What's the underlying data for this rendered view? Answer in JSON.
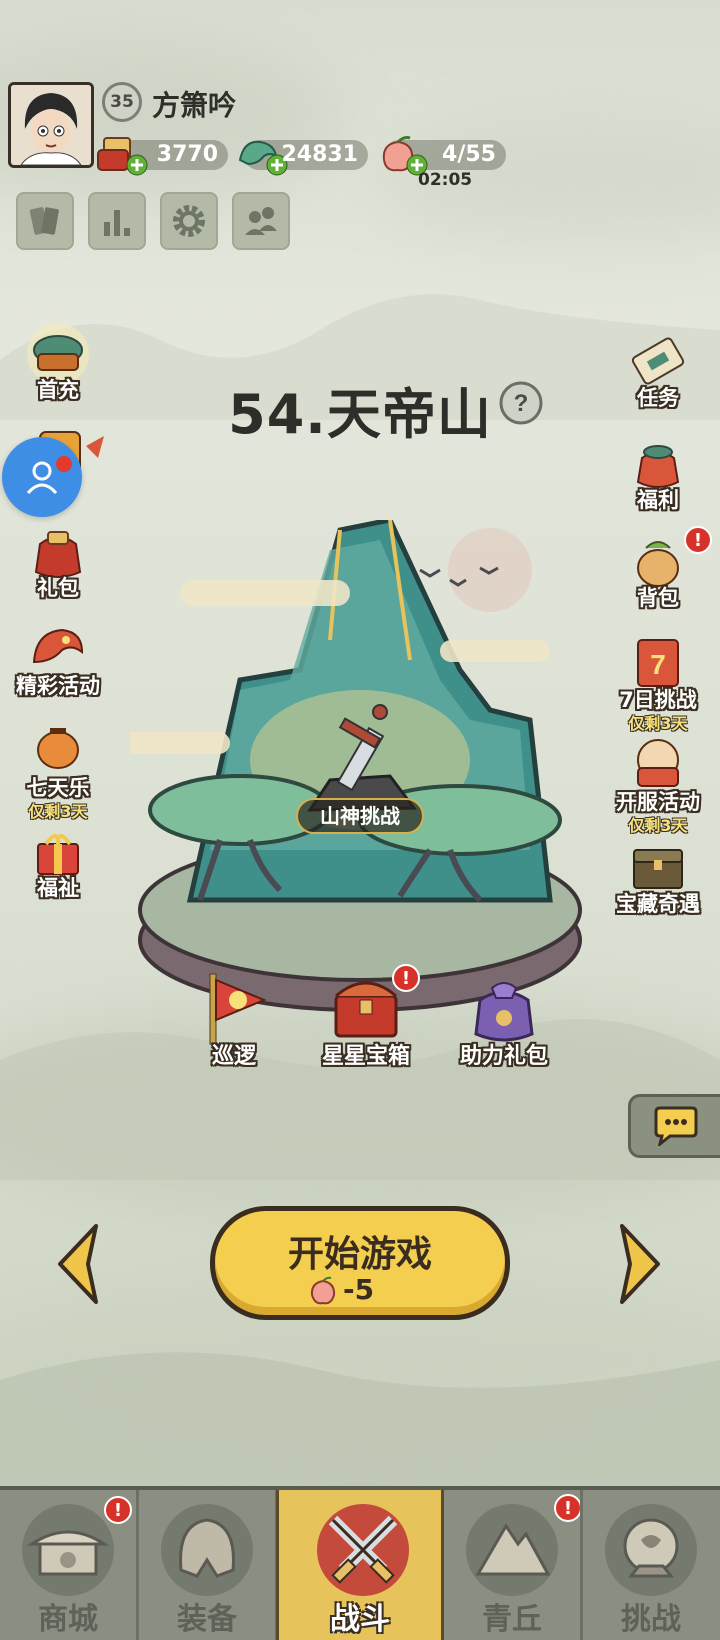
{
  "player": {
    "level": "35",
    "name": "方箫吟",
    "gold": "3770",
    "jade": "24831",
    "stamina": "4/55",
    "stamina_timer": "02:05"
  },
  "stage": {
    "title": "54.天帝山",
    "challenge_label": "山神挑战"
  },
  "left_menu": [
    {
      "label": "首充",
      "icon": "first-recharge-icon"
    },
    {
      "label": "礼包",
      "icon": "gift-bag-icon"
    },
    {
      "label": "精彩活动",
      "icon": "dragon-event-icon"
    },
    {
      "label": "七天乐",
      "sub": "仅剩3天",
      "icon": "lantern-icon"
    },
    {
      "label": "福祉",
      "icon": "gift-box-icon"
    }
  ],
  "right_menu": [
    {
      "label": "任务",
      "icon": "scroll-icon"
    },
    {
      "label": "福利",
      "icon": "money-bag-icon"
    },
    {
      "label": "背包",
      "icon": "backpack-icon"
    },
    {
      "label": "7日挑战",
      "sub": "仅剩3天",
      "icon": "seven-day-icon"
    },
    {
      "label": "开服活动",
      "sub": "仅剩3天",
      "icon": "server-open-icon"
    },
    {
      "label": "宝藏奇遇",
      "icon": "treasure-chest-icon"
    }
  ],
  "island_items": [
    {
      "label": "巡逻",
      "icon": "patrol-flag-icon"
    },
    {
      "label": "星星宝箱",
      "icon": "star-chest-icon"
    },
    {
      "label": "助力礼包",
      "icon": "purple-bag-icon"
    }
  ],
  "start": {
    "label": "开始游戏",
    "cost": "-5"
  },
  "nav": [
    {
      "label": "商城"
    },
    {
      "label": "装备"
    },
    {
      "label": "战斗"
    },
    {
      "label": "青丘"
    },
    {
      "label": "挑战"
    }
  ],
  "colors": {
    "accent_yellow": "#f4cf4f",
    "badge_red": "#d7322a",
    "nav_bg": "#8b8f82",
    "float_blue": "#3f8ee6"
  }
}
